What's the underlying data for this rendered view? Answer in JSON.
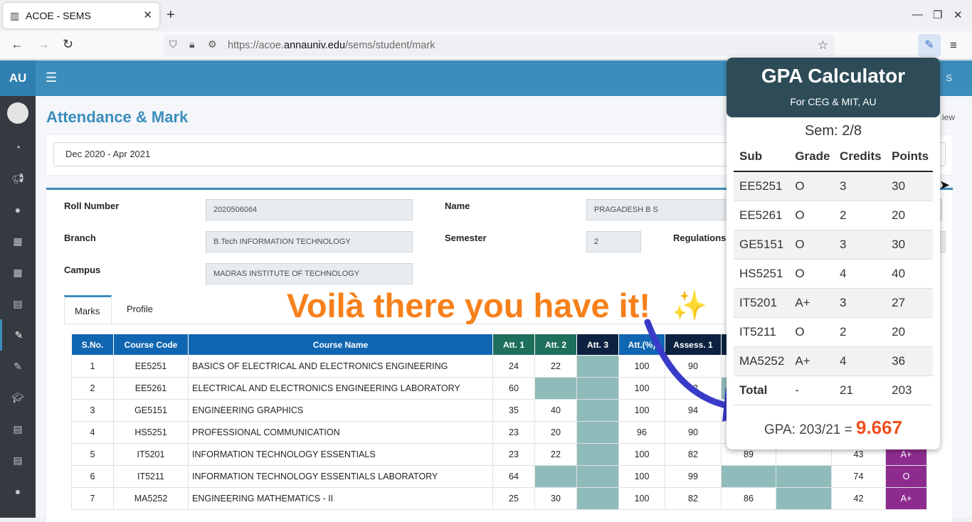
{
  "browser": {
    "tab_title": "ACOE - SEMS",
    "url_prefix": "https://acoe.",
    "url_domain": "annauniv.edu",
    "url_path": "/sems/student/mark"
  },
  "sidebar": {
    "brand": "AU"
  },
  "header": {
    "user": "B S"
  },
  "page": {
    "title": "Attendance & Mark",
    "crumb": "iew",
    "session": "Dec 2020 - Apr 2021"
  },
  "student": {
    "roll_label": "Roll Number",
    "roll": "2020506064",
    "name_label": "Name",
    "name": "PRAGADESH B S",
    "branch_label": "Branch",
    "branch": "B.Tech INFORMATION TECHNOLOGY",
    "semester_label": "Semester",
    "semester": "2",
    "regulations_label": "Regulations",
    "campus_label": "Campus",
    "campus": "MADRAS INSTITUTE OF TECHNOLOGY"
  },
  "tabs": {
    "marks": "Marks",
    "profile": "Profile"
  },
  "marks_table": {
    "headers": [
      "S.No.",
      "Course Code",
      "Course Name",
      "Att. 1",
      "Att. 2",
      "Att. 3",
      "Att.(%)",
      "Assess. 1"
    ],
    "rows": [
      {
        "sno": "1",
        "code": "EE5251",
        "name": "BASICS OF ELECTRICAL AND ELECTRONICS ENGINEERING",
        "a1": "24",
        "a2": "22",
        "pct": "100",
        "as1": "90",
        "as2": "",
        "total": "",
        "grade": ""
      },
      {
        "sno": "2",
        "code": "EE5261",
        "name": "ELECTRICAL AND ELECTRONICS ENGINEERING LABORATORY",
        "a1": "60",
        "a2": "",
        "pct": "100",
        "as1": "82",
        "as2": "",
        "total": "",
        "grade": ""
      },
      {
        "sno": "3",
        "code": "GE5151",
        "name": "ENGINEERING GRAPHICS",
        "a1": "35",
        "a2": "40",
        "pct": "100",
        "as1": "94",
        "as2": "",
        "total": "",
        "grade": ""
      },
      {
        "sno": "4",
        "code": "HS5251",
        "name": "PROFESSIONAL COMMUNICATION",
        "a1": "23",
        "a2": "20",
        "pct": "96",
        "as1": "90",
        "as2": "",
        "total": "",
        "grade": ""
      },
      {
        "sno": "5",
        "code": "IT5201",
        "name": "INFORMATION TECHNOLOGY ESSENTIALS",
        "a1": "23",
        "a2": "22",
        "pct": "100",
        "as1": "82",
        "as2": "89",
        "total": "43",
        "grade": "A+"
      },
      {
        "sno": "6",
        "code": "IT5211",
        "name": "INFORMATION TECHNOLOGY ESSENTIALS LABORATORY",
        "a1": "64",
        "a2": "",
        "pct": "100",
        "as1": "99",
        "as2": "",
        "total": "74",
        "grade": "O"
      },
      {
        "sno": "7",
        "code": "MA5252",
        "name": "ENGINEERING MATHEMATICS - II",
        "a1": "25",
        "a2": "30",
        "pct": "100",
        "as1": "82",
        "as2": "86",
        "total": "42",
        "grade": "A+"
      }
    ]
  },
  "overlay": {
    "caption": "Voilà there you have it!",
    "sparkle": "✨"
  },
  "gpa_calc": {
    "title": "GPA Calculator",
    "subtitle": "For CEG & MIT, AU",
    "sem": "Sem: 2/8",
    "headers": [
      "Sub",
      "Grade",
      "Credits",
      "Points"
    ],
    "rows": [
      [
        "EE5251",
        "O",
        "3",
        "30"
      ],
      [
        "EE5261",
        "O",
        "2",
        "20"
      ],
      [
        "GE5151",
        "O",
        "3",
        "30"
      ],
      [
        "HS5251",
        "O",
        "4",
        "40"
      ],
      [
        "IT5201",
        "A+",
        "3",
        "27"
      ],
      [
        "IT5211",
        "O",
        "2",
        "20"
      ],
      [
        "MA5252",
        "A+",
        "4",
        "36"
      ]
    ],
    "total": [
      "Total",
      "-",
      "21",
      "203"
    ],
    "gpa_text": "GPA: 203/21 =",
    "gpa_value": "9.667"
  }
}
